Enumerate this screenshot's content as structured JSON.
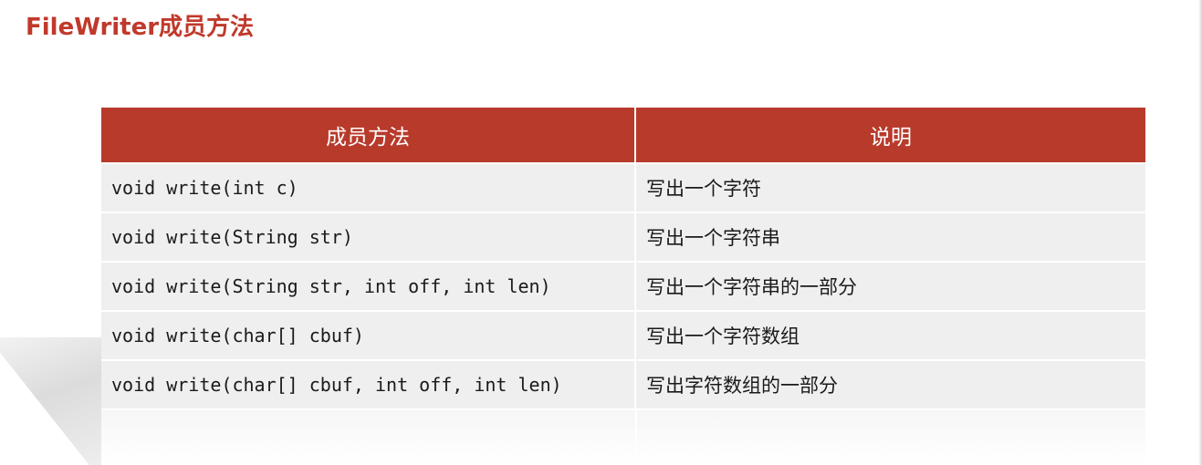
{
  "page": {
    "title": "FileWriter成员方法"
  },
  "table": {
    "headers": [
      "成员方法",
      "说明"
    ],
    "rows": [
      {
        "method": "void write(int c)",
        "description": "写出一个字符"
      },
      {
        "method": "void write(String str)",
        "description": "写出一个字符串"
      },
      {
        "method": "void write(String str, int off, int len)",
        "description": "写出一个字符串的一部分"
      },
      {
        "method": "void write(char[] cbuf)",
        "description": "写出一个字符数组"
      },
      {
        "method": "void write(char[] cbuf, int off, int len)",
        "description": "写出字符数组的一部分"
      }
    ]
  },
  "colors": {
    "title": "#c0392b",
    "header_background": "#b83a2b",
    "header_text": "#ffffff",
    "row_background": "#efefef"
  }
}
